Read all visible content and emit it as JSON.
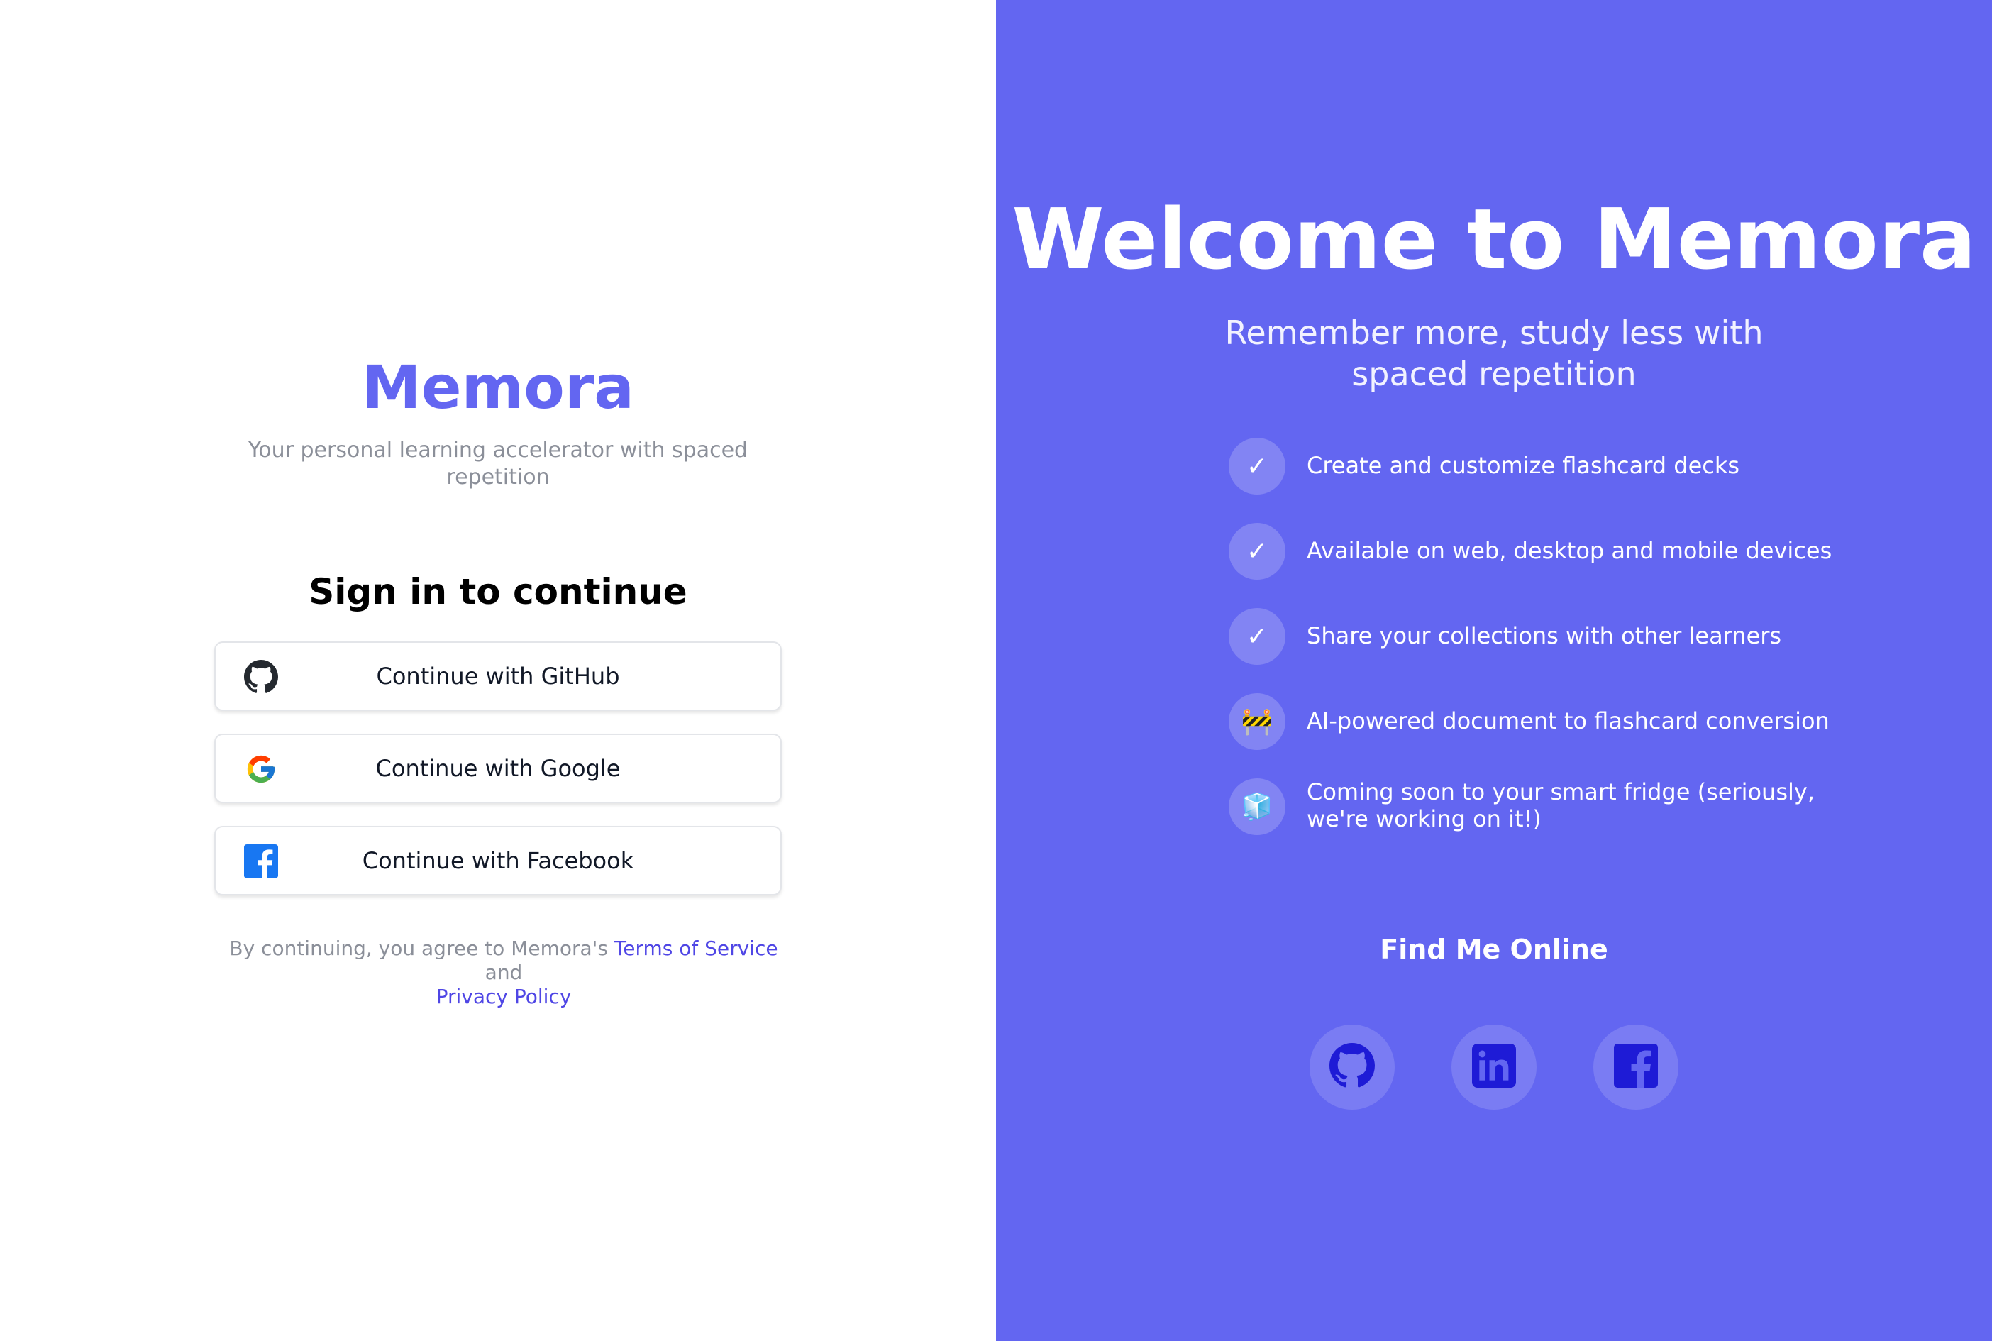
{
  "left": {
    "brand": "Memora",
    "tagline": "Your personal learning accelerator with spaced repetition",
    "signin_title": "Sign in to continue",
    "buttons": [
      {
        "label": "Continue with GitHub",
        "icon": "github-icon"
      },
      {
        "label": "Continue with Google",
        "icon": "google-icon"
      },
      {
        "label": "Continue with Facebook",
        "icon": "facebook-icon"
      }
    ],
    "legal": {
      "prefix": "By continuing, you agree to Memora's",
      "terms": "Terms of Service",
      "conjunction": "and",
      "privacy": "Privacy Policy"
    }
  },
  "right": {
    "welcome": "Welcome to Memora",
    "subtitle": "Remember more, study less with spaced repetition",
    "features": [
      {
        "icon": "✓",
        "text": "Create and customize flashcard decks"
      },
      {
        "icon": "✓",
        "text": "Available on web, desktop and mobile devices"
      },
      {
        "icon": "✓",
        "text": "Share your collections with other learners"
      },
      {
        "icon": "🚧",
        "text": "AI-powered document to flashcard conversion"
      },
      {
        "icon": "🧊",
        "text": "Coming soon to your smart fridge (seriously, we're working on it!)"
      }
    ],
    "find_title": "Find Me Online",
    "socials": [
      "github-icon",
      "linkedin-icon",
      "facebook-icon"
    ]
  },
  "colors": {
    "accent": "#6366f1",
    "link": "#4f46e5",
    "muted_text": "#8b8f99",
    "social_icon": "#1e1bd6",
    "facebook_blue": "#1877f2"
  }
}
